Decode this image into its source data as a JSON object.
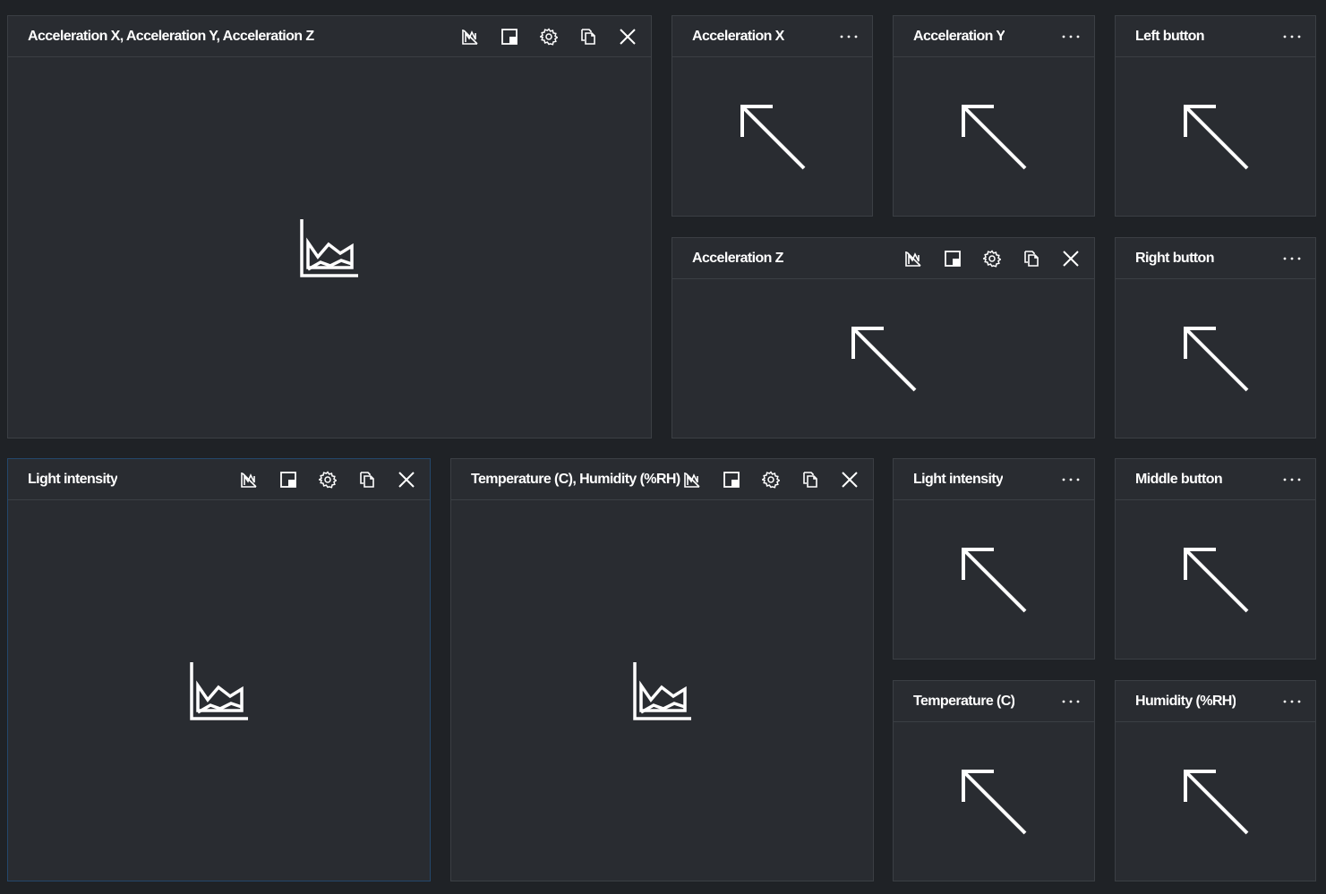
{
  "tiles": {
    "accel_xyz": {
      "title": "Acceleration X, Acceleration Y, Acceleration Z",
      "body_icon": "area-chart-icon"
    },
    "accel_x": {
      "title": "Acceleration X",
      "body_icon": "arrow-up-left-icon"
    },
    "accel_y": {
      "title": "Acceleration Y",
      "body_icon": "arrow-up-left-icon"
    },
    "left_button": {
      "title": "Left button",
      "body_icon": "arrow-up-left-icon"
    },
    "accel_z": {
      "title": "Acceleration Z",
      "body_icon": "arrow-up-left-icon"
    },
    "right_button": {
      "title": "Right button",
      "body_icon": "arrow-up-left-icon"
    },
    "light_chart": {
      "title": "Light intensity",
      "body_icon": "area-chart-icon"
    },
    "temp_humidity_chart": {
      "title": "Temperature (C), Humidity (%RH)",
      "body_icon": "area-chart-icon"
    },
    "light_tile": {
      "title": "Light intensity",
      "body_icon": "arrow-up-left-icon"
    },
    "middle_button": {
      "title": "Middle button",
      "body_icon": "arrow-up-left-icon"
    },
    "temperature": {
      "title": "Temperature (C)",
      "body_icon": "arrow-up-left-icon"
    },
    "humidity": {
      "title": "Humidity (%RH)",
      "body_icon": "arrow-up-left-icon"
    }
  },
  "toolbar_icons": [
    "chart-type-icon",
    "pin-icon",
    "gear-icon",
    "copy-icon",
    "close-icon"
  ],
  "colors": {
    "background": "#1f2226",
    "tile": "#292c31",
    "border": "#3b3f44",
    "selected_border": "#24476b",
    "text": "#ffffff"
  }
}
